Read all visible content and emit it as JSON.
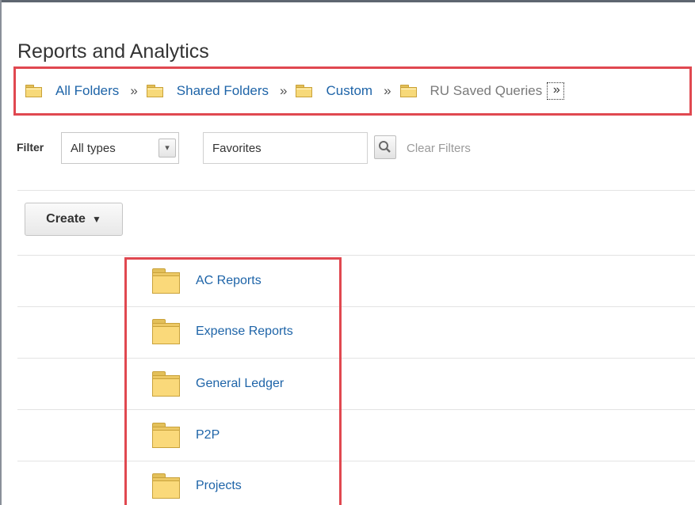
{
  "page": {
    "title": "Reports and Analytics"
  },
  "breadcrumb": {
    "items": [
      {
        "label": "All Folders"
      },
      {
        "label": "Shared Folders"
      },
      {
        "label": "Custom"
      },
      {
        "label": "RU Saved Queries"
      }
    ],
    "separator": "»",
    "more_glyph": "»"
  },
  "filter": {
    "label": "Filter",
    "type_value": "All types",
    "dropdown_glyph": "▾",
    "search_value": "Favorites",
    "clear_label": "Clear Filters"
  },
  "toolbar": {
    "create_label": "Create",
    "create_glyph": "▼"
  },
  "folders": [
    {
      "name": "AC Reports"
    },
    {
      "name": "Expense Reports"
    },
    {
      "name": "General Ledger"
    },
    {
      "name": "P2P"
    },
    {
      "name": "Projects"
    }
  ],
  "icons": {
    "folder": "folder-icon",
    "search": "search-icon",
    "chevron": "chevron-down-icon",
    "separator": "double-chevron-right-icon"
  },
  "colors": {
    "link": "#1e64a8",
    "highlight_border": "#e04850",
    "folder_fill": "#fad97a",
    "muted_text": "#9a9a9a"
  }
}
